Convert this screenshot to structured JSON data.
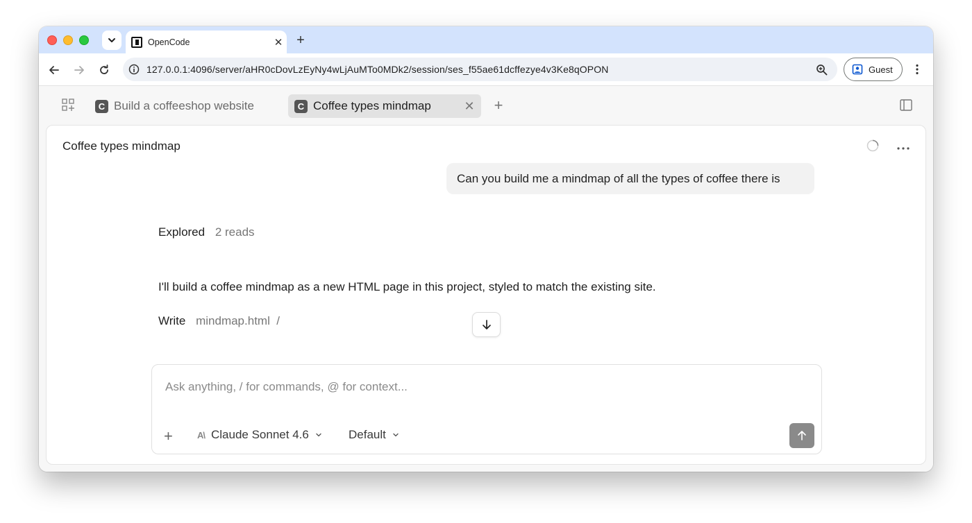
{
  "browser": {
    "tab_title": "OpenCode",
    "url": "127.0.0.1:4096/server/aHR0cDovLzEyNy4wLjAuMTo0MDk2/session/ses_f55ae61dcffezye4v3Ke8qOPON",
    "profile_label": "Guest"
  },
  "app": {
    "tabs": [
      {
        "badge": "C",
        "label": "Build a coffeeshop website"
      },
      {
        "badge": "C",
        "label": "Coffee types mindmap"
      }
    ],
    "session_title": "Coffee types mindmap",
    "user_message": "Can you build me a mindmap of all the types of coffee there is",
    "explored_label": "Explored",
    "explored_detail": "2 reads",
    "assistant_text": "I'll build a coffee mindmap as a new HTML page in this project, styled to match the existing site.",
    "write_label": "Write",
    "write_detail": "mindmap.html  /",
    "composer": {
      "placeholder": "Ask anything, / for commands, @ for context...",
      "model": "Claude Sonnet 4.6",
      "mode": "Default"
    }
  },
  "colors": {
    "tabstrip": "#d3e3fd",
    "send_button": "#8a8a8a",
    "active_app_tab": "#e2e2e2"
  },
  "icons": {
    "close_window": "red-traffic-light",
    "minimize": "yellow-traffic-light",
    "zoom": "green-traffic-light"
  }
}
